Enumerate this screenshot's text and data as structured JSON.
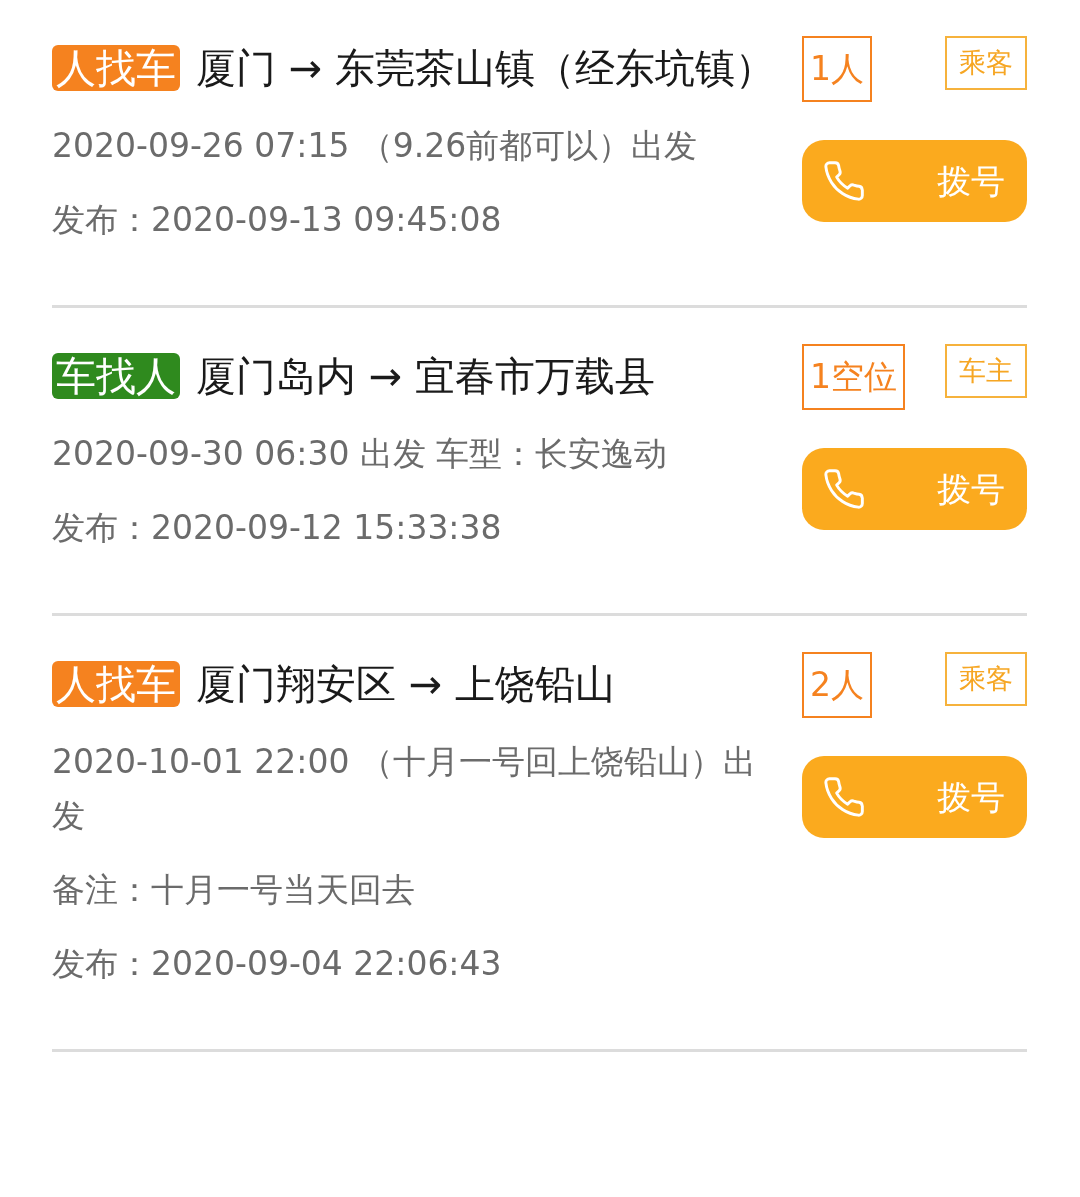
{
  "listings": [
    {
      "kind": "seek_car",
      "badge": "人找车",
      "route": "厦门 → 东莞茶山镇（经东坑镇）",
      "count": "1人",
      "role": "乘客",
      "call": "拨号",
      "lines": [
        "2020-09-26 07:15 （9.26前都可以）出发",
        "发布：2020-09-13 09:45:08"
      ]
    },
    {
      "kind": "seek_person",
      "badge": "车找人",
      "route": "厦门岛内 → 宜春市万载县",
      "count": "1空位",
      "role": "车主",
      "call": "拨号",
      "lines": [
        "2020-09-30 06:30 出发 车型：长安逸动",
        "发布：2020-09-12 15:33:38"
      ]
    },
    {
      "kind": "seek_car",
      "badge": "人找车",
      "route": "厦门翔安区 → 上饶铅山",
      "count": "2人",
      "role": "乘客",
      "call": "拨号",
      "lines": [
        "2020-10-01 22:00 （十月一号回上饶铅山）出发",
        "备注：十月一号当天回去",
        "发布：2020-09-04 22:06:43"
      ]
    }
  ]
}
